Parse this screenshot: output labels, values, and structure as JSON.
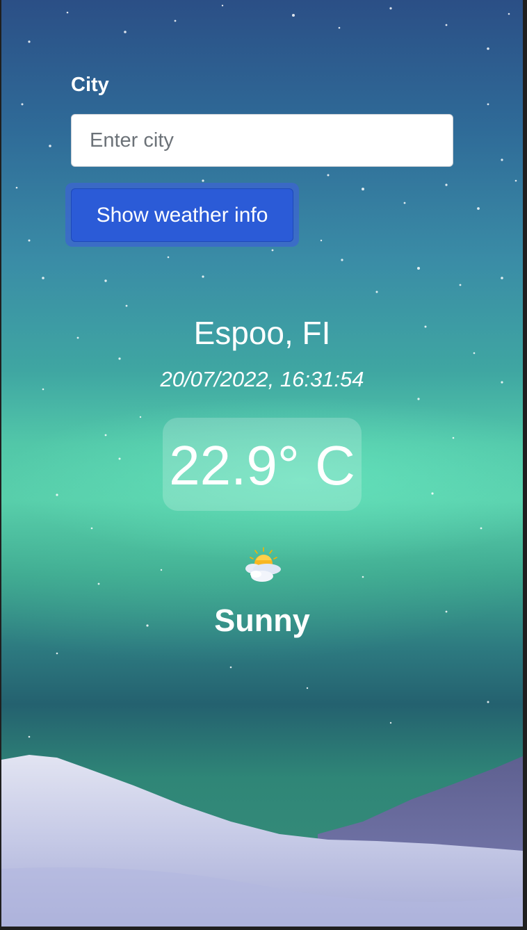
{
  "form": {
    "city_label": "City",
    "city_input_placeholder": "Enter city",
    "city_input_value": "",
    "show_button_label": "Show weather info"
  },
  "weather": {
    "location": "Espoo, FI",
    "datetime": "20/07/2022, 16:31:54",
    "temperature": "22.9° C",
    "condition": "Sunny",
    "icon": "sun-behind-cloud-icon"
  }
}
